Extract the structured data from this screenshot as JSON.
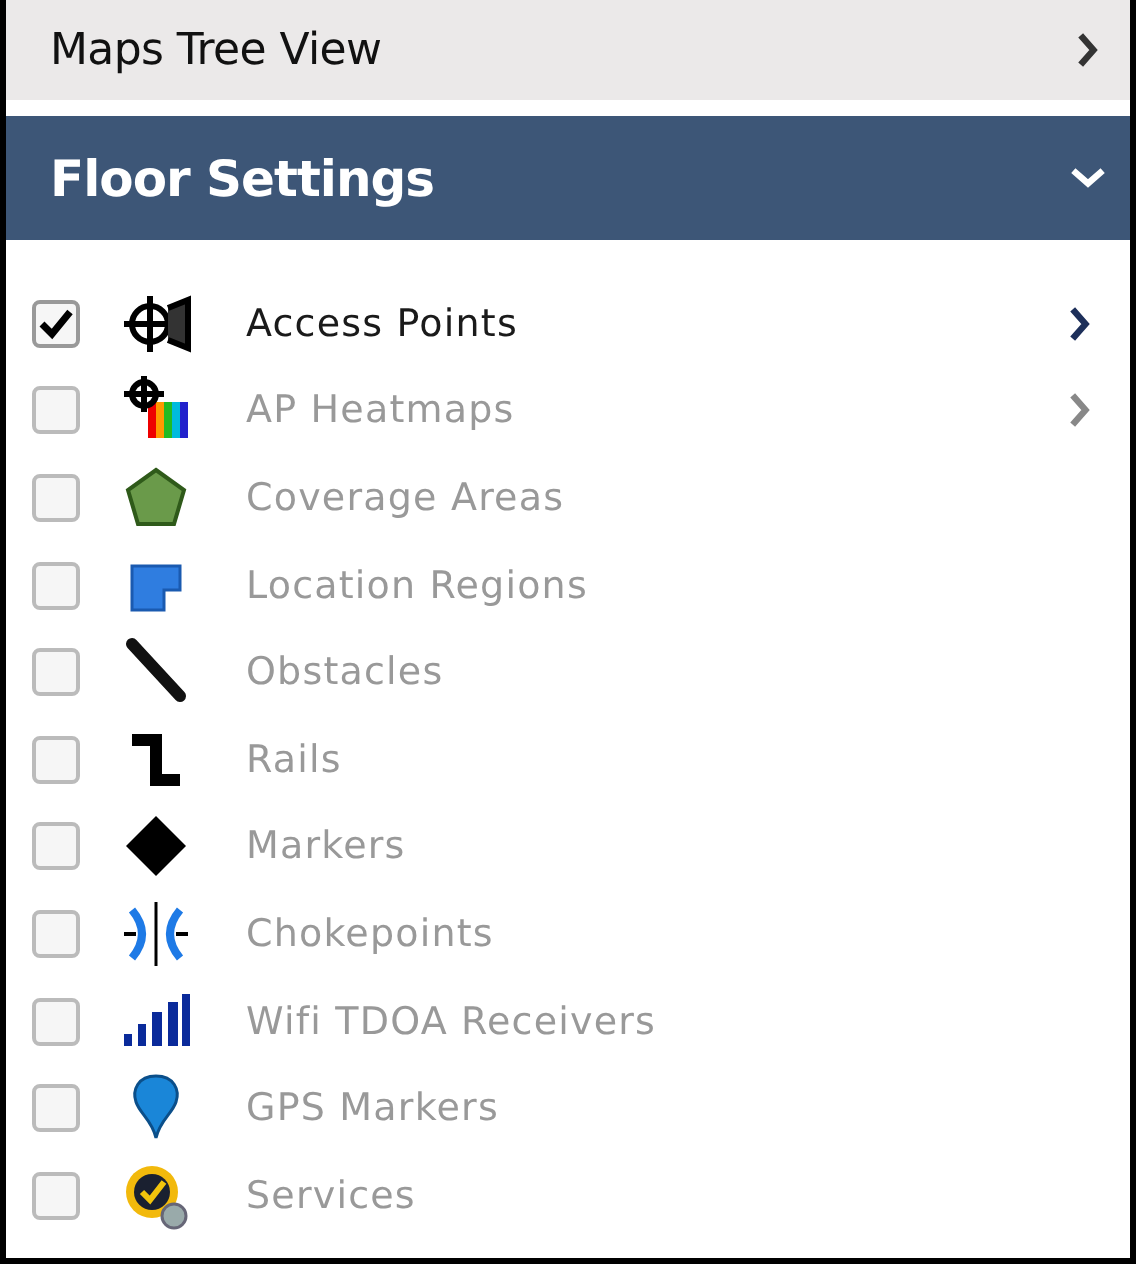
{
  "panels": [
    {
      "title": "Maps Tree View",
      "expanded": false
    },
    {
      "title": "Floor Settings",
      "expanded": true
    }
  ],
  "items": [
    {
      "label": "Access Points",
      "checked": true,
      "has_submenu": true
    },
    {
      "label": "AP Heatmaps",
      "checked": false,
      "has_submenu": true
    },
    {
      "label": "Coverage Areas",
      "checked": false,
      "has_submenu": false
    },
    {
      "label": "Location Regions",
      "checked": false,
      "has_submenu": false
    },
    {
      "label": "Obstacles",
      "checked": false,
      "has_submenu": false
    },
    {
      "label": "Rails",
      "checked": false,
      "has_submenu": false
    },
    {
      "label": "Markers",
      "checked": false,
      "has_submenu": false
    },
    {
      "label": "Chokepoints",
      "checked": false,
      "has_submenu": false
    },
    {
      "label": "Wifi TDOA Receivers",
      "checked": false,
      "has_submenu": false
    },
    {
      "label": "GPS Markers",
      "checked": false,
      "has_submenu": false
    },
    {
      "label": "Services",
      "checked": false,
      "has_submenu": false
    }
  ]
}
